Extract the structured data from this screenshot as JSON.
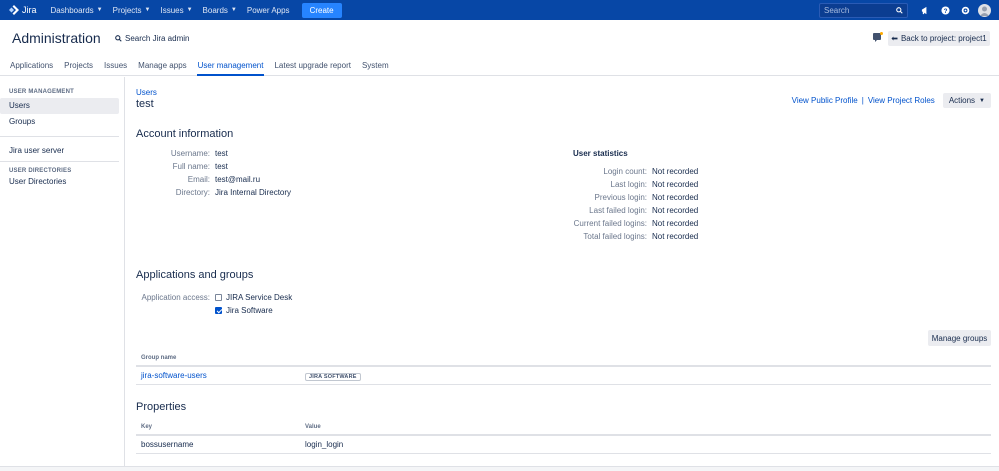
{
  "topnav": {
    "logo_text": "Jira",
    "items": [
      {
        "label": "Dashboards",
        "dropdown": true
      },
      {
        "label": "Projects",
        "dropdown": true
      },
      {
        "label": "Issues",
        "dropdown": true
      },
      {
        "label": "Boards",
        "dropdown": true
      },
      {
        "label": "Power Apps",
        "dropdown": false
      }
    ],
    "create_label": "Create",
    "search_placeholder": "Search",
    "icons": [
      "bullhorn-icon",
      "help-icon",
      "settings-icon",
      "avatar"
    ]
  },
  "admin": {
    "title": "Administration",
    "search_label": "Search Jira admin",
    "back_label": "Back to project: project1"
  },
  "tabs": [
    "Applications",
    "Projects",
    "Issues",
    "Manage apps",
    "User management",
    "Latest upgrade report",
    "System"
  ],
  "active_tab": "User management",
  "sidebar": {
    "group1_heading": "USER MANAGEMENT",
    "users": "Users",
    "groups": "Groups",
    "jira_user_server": "Jira user server",
    "group2_heading": "USER DIRECTORIES",
    "user_directories": "User Directories"
  },
  "main": {
    "breadcrumb": "Users",
    "user_title": "test",
    "view_public_profile": "View Public Profile",
    "separator": "|",
    "view_project_roles": "View Project Roles",
    "actions_label": "Actions",
    "account_info_heading": "Account information",
    "account": {
      "username_label": "Username:",
      "username": "test",
      "fullname_label": "Full name:",
      "fullname": "test",
      "email_label": "Email:",
      "email": "test@mail.ru",
      "directory_label": "Directory:",
      "directory": "Jira Internal Directory"
    },
    "stats_heading": "User statistics",
    "stats": {
      "login_count_label": "Login count:",
      "login_count": "Not recorded",
      "last_login_label": "Last login:",
      "last_login": "Not recorded",
      "previous_login_label": "Previous login:",
      "previous_login": "Not recorded",
      "last_failed_label": "Last failed login:",
      "last_failed": "Not recorded",
      "current_failed_label": "Current failed logins:",
      "current_failed": "Not recorded",
      "total_failed_label": "Total failed logins:",
      "total_failed": "Not recorded"
    },
    "apps_heading": "Applications and groups",
    "app_access_label": "Application access:",
    "apps": [
      {
        "label": "JIRA Service Desk",
        "checked": false
      },
      {
        "label": "Jira Software",
        "checked": true
      }
    ],
    "manage_groups_label": "Manage groups",
    "groups_table": {
      "col_group": "Group name",
      "row_group": "jira-software-users",
      "row_badge": "JIRA SOFTWARE"
    },
    "properties_heading": "Properties",
    "properties_table": {
      "col_key": "Key",
      "col_value": "Value",
      "row_key": "bossusername",
      "row_value": "login_login"
    }
  }
}
